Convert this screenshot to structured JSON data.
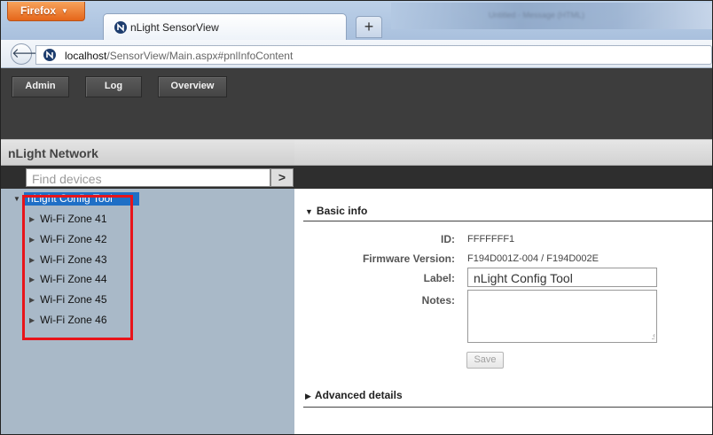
{
  "browser": {
    "menu_label": "Firefox",
    "tab_title": "nLight SensorView",
    "new_tab_symbol": "+",
    "url_host": "localhost",
    "url_path": "/SensorView/Main.aspx#pnlInfoContent",
    "background_tab_text": "Untitled - Message (HTML)"
  },
  "app": {
    "menu": [
      "Admin",
      "Log",
      "Overview"
    ]
  },
  "left_panel": {
    "title": "nLight Network",
    "search_placeholder": "Find devices",
    "search_button": ">",
    "root_node": "nLight Config Tool",
    "zones": [
      "Wi-Fi Zone 41",
      "Wi-Fi Zone 42",
      "Wi-Fi Zone 43",
      "Wi-Fi Zone 44",
      "Wi-Fi Zone 45",
      "Wi-Fi Zone 46"
    ],
    "highlight_color": "#e8141a"
  },
  "basic_info": {
    "heading": "Basic info",
    "id_label": "ID:",
    "id_value": "FFFFFFF1",
    "firmware_label": "Firmware Version:",
    "firmware_value": "F194D001Z-004 / F194D002E",
    "label_label": "Label:",
    "label_value": "nLight Config Tool",
    "notes_label": "Notes:",
    "notes_value": "",
    "save_button": "Save"
  },
  "advanced": {
    "heading": "Advanced details"
  },
  "colors": {
    "header_bg": "#3d3d3d",
    "panel_bg": "#a9b9c8",
    "selection": "#1f6fc6"
  }
}
